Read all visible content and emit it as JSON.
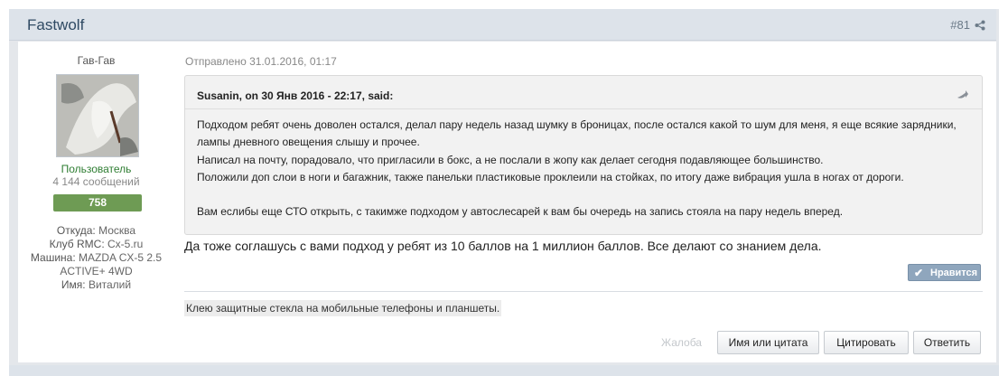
{
  "header": {
    "author": "Fastwolf",
    "post_number": "#81"
  },
  "author_panel": {
    "user_title": "Гав-Гав",
    "group": "Пользователь",
    "post_count": "4 144 сообщений",
    "reputation": "758",
    "fields": [
      {
        "label": "Откуда: ",
        "value": "Москва"
      },
      {
        "label": "Клуб RMC: ",
        "value": "Cx-5.ru"
      },
      {
        "label": "Машина: ",
        "value": "MAZDA CX-5 2.5"
      },
      {
        "label": "",
        "value": "ACTIVE+ 4WD"
      },
      {
        "label": "Имя: ",
        "value": "Виталий"
      }
    ]
  },
  "post": {
    "date": "Отправлено 31.01.2016, 01:17",
    "quote": {
      "title": "Susanin, on 30 Янв 2016 - 22:17, said:",
      "lines": [
        "Подходом ребят очень доволен остался, делал пару недель назад шумку в броницах, после остался какой то шум для меня, я еще всякие зарядники,",
        "лампы дневного овещения слышу и прочее.",
        "Написал на почту, порадовало, что пригласили в бокс, а не послали в жопу как делает сегодня подавляющее большинство.",
        "Положили доп слои в ноги и багажник, также панельки пластиковые проклеили на стойках, по итогу даже вибрация ушла в ногах от дороги."
      ],
      "last_line": "Вам еслибы еще СТО открыть, с такимже подходом у автослесарей к вам бы очередь на запись стояла на пару недель вперед."
    },
    "text": "Да тоже соглашусь с вами подход у ребят из 10 баллов на 1 миллион баллов. Все делают со знанием дела.",
    "like_label": "Нравится",
    "signature": "Клею защитные стекла на мобильные телефоны и планшеты."
  },
  "actions": {
    "report": "Жалоба",
    "name_or_quote": "Имя или цитата",
    "quote": "Цитировать",
    "reply": "Ответить"
  },
  "colors": {
    "header_bg": "#dde3ea",
    "reputation_bg": "#6e9b54",
    "group_color": "#2e7d32",
    "like_bg": "#8fa6bd"
  },
  "icons": {
    "share": "share-icon",
    "quote": "quote-icon",
    "like_check": "check-icon"
  }
}
